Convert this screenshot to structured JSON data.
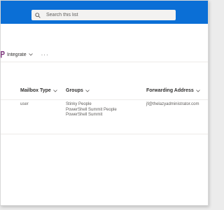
{
  "search": {
    "placeholder": "Search this list"
  },
  "commandbar": {
    "integrate_label": "Integrate",
    "more_label": "···"
  },
  "columns": {
    "mailbox_type": "Mailbox Type",
    "groups": "Groups",
    "forwarding_address": "Forwarding Address"
  },
  "rows": [
    {
      "mailbox_type": "user",
      "groups": [
        "Stinky People",
        "PowerShell Summit People",
        "PowerShell Summit"
      ],
      "forwarding_address": "jf@thelazyadministrator.com"
    }
  ],
  "colors": {
    "topbar": "#0b6fd6",
    "powerapps_accent": "#742774"
  }
}
